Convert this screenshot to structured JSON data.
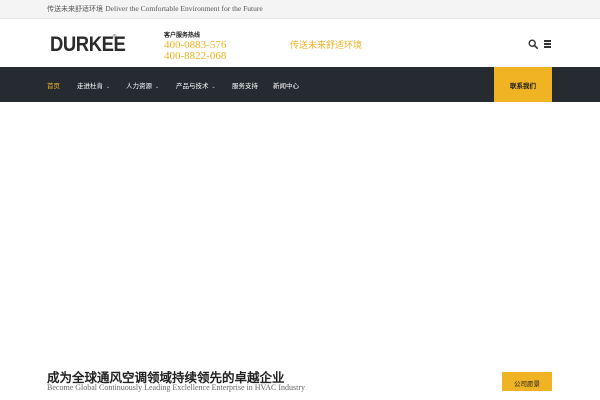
{
  "topbar": {
    "tagline_cn": "传送未来舒适环境",
    "tagline_en": "Deliver the Comfortable Environment for the Future"
  },
  "header": {
    "logo_text": "DURKEE",
    "logo_mark": "®",
    "hotline_label": "客户服务热线",
    "hotline_numbers": [
      "400-0883-576",
      "400-8822-068"
    ],
    "slogan": "传送未来舒适环境",
    "icons": [
      "search-icon",
      "menu-icon"
    ]
  },
  "nav": {
    "items": [
      {
        "label": "首页",
        "active": true,
        "dropdown": false
      },
      {
        "label": "走进杜肯",
        "active": false,
        "dropdown": true
      },
      {
        "label": "人力资源",
        "active": false,
        "dropdown": true
      },
      {
        "label": "产品与技术",
        "active": false,
        "dropdown": true
      },
      {
        "label": "服务支持",
        "active": false,
        "dropdown": false
      },
      {
        "label": "新闻中心",
        "active": false,
        "dropdown": false
      }
    ],
    "contact_label": "联系我们"
  },
  "hero": {
    "title": "成为全球通风空调领域持续领先的卓越企业",
    "subtitle": "Become Global Continuously Leading Exclellence Enterprise in HVAC Industry",
    "button_label": "公司愿景"
  },
  "colors": {
    "accent": "#f0b323",
    "nav_bg": "#262b31",
    "topbar_bg": "#f4f4f4"
  }
}
